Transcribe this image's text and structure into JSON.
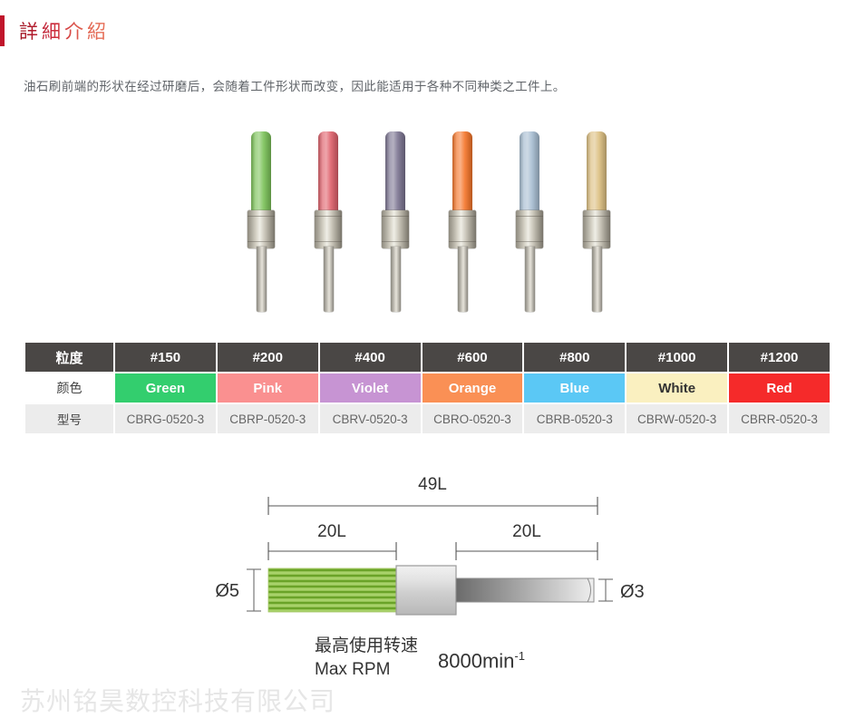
{
  "header": {
    "title": "詳細介紹",
    "accent_bar_color": "#c0152b",
    "title_gradient_from": "#9e1220",
    "title_gradient_to": "#e8735a"
  },
  "intro": {
    "text": "油石刷前端的形状在经过研磨后，会随着工件形状而改变，因此能适用于各种不同种类之工件上。"
  },
  "brushes": [
    {
      "name": "green-brush",
      "head_color": "#7ec45c"
    },
    {
      "name": "pink-brush",
      "head_color": "#e0646e"
    },
    {
      "name": "violet-brush",
      "head_color": "#7e7793"
    },
    {
      "name": "orange-brush",
      "head_color": "#f5782e"
    },
    {
      "name": "blue-brush",
      "head_color": "#a8bed2"
    },
    {
      "name": "tan-brush",
      "head_color": "#ddc083"
    }
  ],
  "table": {
    "row_labels": {
      "grit": "粒度",
      "color": "颜色",
      "model": "型号"
    },
    "columns": [
      {
        "grit": "#150",
        "color_name": "Green",
        "cell_bg": "#33ce6e",
        "cell_fg": "#ffffff",
        "model": "CBRG-0520-3"
      },
      {
        "grit": "#200",
        "color_name": "Pink",
        "cell_bg": "#fa9090",
        "cell_fg": "#ffffff",
        "model": "CBRP-0520-3"
      },
      {
        "grit": "#400",
        "color_name": "Violet",
        "cell_bg": "#c794d3",
        "cell_fg": "#ffffff",
        "model": "CBRV-0520-3"
      },
      {
        "grit": "#600",
        "color_name": "Orange",
        "cell_bg": "#fa9055",
        "cell_fg": "#ffffff",
        "model": "CBRO-0520-3"
      },
      {
        "grit": "#800",
        "color_name": "Blue",
        "cell_bg": "#5bc8f5",
        "cell_fg": "#ffffff",
        "model": "CBRB-0520-3"
      },
      {
        "grit": "#1000",
        "color_name": "White",
        "cell_bg": "#faf0c0",
        "cell_fg": "#333333",
        "model": "CBRW-0520-3"
      },
      {
        "grit": "#1200",
        "color_name": "Red",
        "cell_bg": "#f52a2a",
        "cell_fg": "#ffffff",
        "model": "CBRR-0520-3"
      }
    ]
  },
  "drawing": {
    "dim_overall": "49L",
    "dim_bristle": "20L",
    "dim_shank": "20L",
    "dia_head": "Ø5",
    "dia_shank": "Ø3",
    "bristle_color": "#8cc63f"
  },
  "rpm": {
    "label_cn": "最高使用转速",
    "label_en": "Max RPM",
    "value": "8000min",
    "exponent": "-1"
  },
  "watermark": {
    "text": "苏州铭昊数控科技有限公司"
  }
}
